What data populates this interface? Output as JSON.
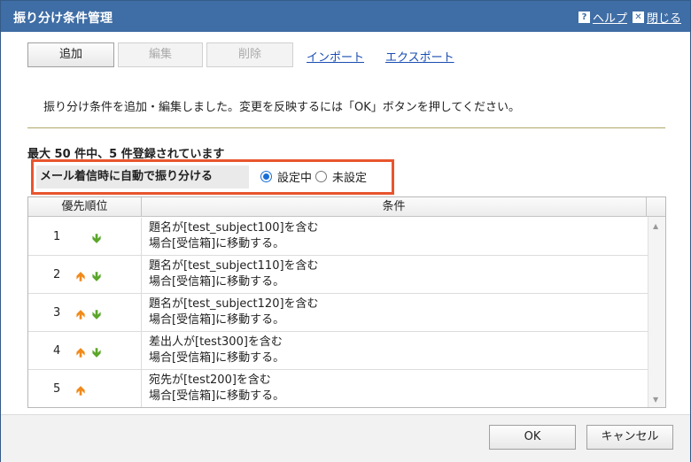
{
  "window": {
    "title": "振り分け条件管理",
    "help_label": "ヘルプ",
    "close_label": "閉じる"
  },
  "toolbar": {
    "add_label": "追加",
    "edit_label": "編集",
    "delete_label": "削除",
    "import_label": "インポート",
    "export_label": "エクスポート"
  },
  "message": "振り分け条件を追加・編集しました。変更を反映するには「OK」ボタンを押してください。",
  "count_text": "最大 50 件中、5 件登録されています",
  "auto_sort": {
    "label": "メール着信時に自動で振り分ける",
    "option_on": "設定中",
    "option_off": "未設定",
    "selected": "設定中"
  },
  "table": {
    "headers": [
      "優先順位",
      "条件"
    ],
    "rows": [
      {
        "priority": "1",
        "up": false,
        "down": true,
        "line1": "題名が[test_subject100]を含む",
        "line2": "場合[受信箱]に移動する。"
      },
      {
        "priority": "2",
        "up": true,
        "down": true,
        "line1": "題名が[test_subject110]を含む",
        "line2": "場合[受信箱]に移動する。"
      },
      {
        "priority": "3",
        "up": true,
        "down": true,
        "line1": "題名が[test_subject120]を含む",
        "line2": "場合[受信箱]に移動する。"
      },
      {
        "priority": "4",
        "up": true,
        "down": true,
        "line1": "差出人が[test300]を含む",
        "line2": "場合[受信箱]に移動する。"
      },
      {
        "priority": "5",
        "up": true,
        "down": false,
        "line1": "宛先が[test200]を含む",
        "line2": "場合[受信箱]に移動する。"
      }
    ]
  },
  "footer": {
    "ok_label": "OK",
    "cancel_label": "キャンセル"
  },
  "colors": {
    "titlebar": "#3f6da5",
    "highlight_border": "#e8552e",
    "arrow_up": "#f08a1a",
    "arrow_down": "#5aa62a",
    "link": "#1a4db3"
  }
}
